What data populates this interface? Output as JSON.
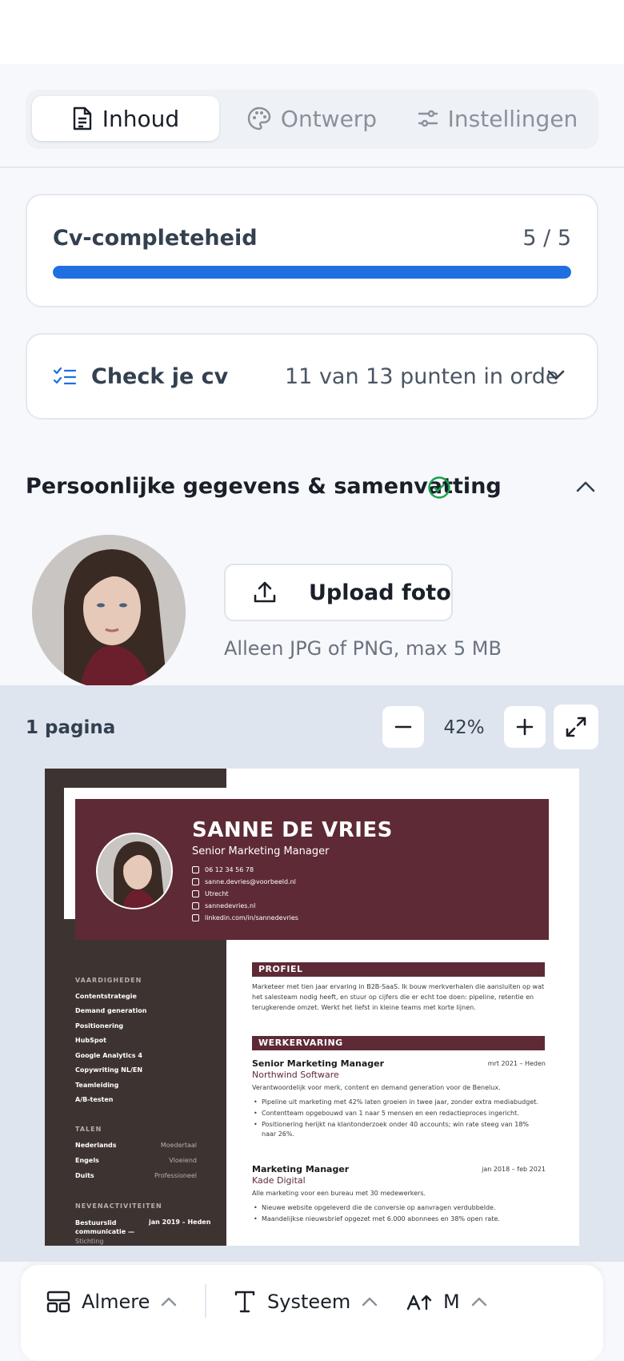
{
  "tabs": [
    {
      "label": "Inhoud",
      "icon": "document-icon"
    },
    {
      "label": "Ontwerp",
      "icon": "palette-icon"
    },
    {
      "label": "Instellingen",
      "icon": "sliders-icon"
    }
  ],
  "completeness": {
    "title": "Cv-completeheid",
    "count": "5 / 5",
    "progress": 1.0
  },
  "check": {
    "title": "Check je cv",
    "status": "11 van 13 punten in orde"
  },
  "section": {
    "title": "Persoonlijke gegevens & samenvatting"
  },
  "upload": {
    "label": "Upload foto",
    "hint": "Alleen JPG of PNG, max 5 MB"
  },
  "preview": {
    "page_count": "1 pagina",
    "zoom": "42%"
  },
  "cv": {
    "name": "SANNE DE VRIES",
    "role": "Senior Marketing Manager",
    "contacts": [
      "06 12 34 56 78",
      "sanne.devries@voorbeeld.nl",
      "Utrecht",
      "sannedevries.nl",
      "linkedin.com/in/sannedevries"
    ],
    "skills_heading": "VAARDIGHEDEN",
    "skills": [
      "Contentstrategie",
      "Demand generation",
      "Positionering",
      "HubSpot",
      "Google Analytics 4",
      "Copywriting NL/EN",
      "Teamleiding",
      "A/B-testen"
    ],
    "languages_heading": "TALEN",
    "languages": [
      {
        "name": "Nederlands",
        "level": "Moedertaal"
      },
      {
        "name": "Engels",
        "level": "Vloeiend"
      },
      {
        "name": "Duits",
        "level": "Professioneel"
      }
    ],
    "side_heading": "NEVENACTIVITEITEN",
    "side_item": {
      "title": "Bestuurslid communicatie —",
      "date": "jan 2019 – Heden",
      "org": "Stichting"
    },
    "profile_heading": "PROFIEL",
    "profile_text": "Marketeer met tien jaar ervaring in B2B-SaaS. Ik bouw merkverhalen die aansluiten op wat het salesteam nodig heeft, en stuur op cijfers die er echt toe doen: pipeline, retentie en terugkerende omzet. Werkt het liefst in kleine teams met korte lijnen.",
    "experience_heading": "WERKERVARING",
    "jobs": [
      {
        "title": "Senior Marketing Manager",
        "date": "mrt 2021 – Heden",
        "company": "Northwind Software",
        "summary": "Verantwoordelijk voor merk, content en demand generation voor de Benelux.",
        "bullets": [
          "Pipeline uit marketing met 42% laten groeien in twee jaar, zonder extra mediabudget.",
          "Contentteam opgebouwd van 1 naar 5 mensen en een redactieproces ingericht.",
          "Positionering herijkt na klantonderzoek onder 40 accounts; win rate steeg van 18% naar 26%."
        ]
      },
      {
        "title": "Marketing Manager",
        "date": "jan 2018 – feb 2021",
        "company": "Kade Digital",
        "summary": "Alle marketing voor een bureau met 30 medewerkers.",
        "bullets": [
          "Nieuwe website opgeleverd die de conversie op aanvragen verdubbelde.",
          "Maandelijkse nieuwsbrief opgezet met 6.000 abonnees en 38% open rate."
        ]
      }
    ]
  },
  "bottom": {
    "template": "Almere",
    "font": "Systeem",
    "size": "M"
  },
  "colors": {
    "accent": "#1f6fe0",
    "cv_header": "#5e2a36",
    "cv_sidebar": "#3d3432",
    "success": "#16a34a"
  }
}
